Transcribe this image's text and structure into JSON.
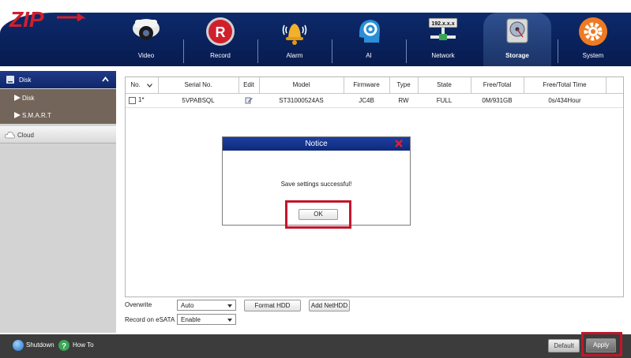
{
  "brand": {
    "logo_text": "ZIP"
  },
  "nav": {
    "items": [
      {
        "label": "Video",
        "icon": "camera-icon"
      },
      {
        "label": "Record",
        "icon": "record-icon"
      },
      {
        "label": "Alarm",
        "icon": "bell-icon"
      },
      {
        "label": "AI",
        "icon": "ai-head-icon"
      },
      {
        "label": "Network",
        "icon": "network-icon",
        "badge": "192.x.x.x"
      },
      {
        "label": "Storage",
        "icon": "hdd-icon",
        "active": true
      },
      {
        "label": "System",
        "icon": "gear-icon"
      }
    ]
  },
  "sidebar": {
    "disk_header": "Disk",
    "disk_items": [
      {
        "label": "Disk"
      },
      {
        "label": "S.M.A.R.T"
      }
    ],
    "cloud_header": "Cloud"
  },
  "table": {
    "headers": [
      "No.",
      "Serial No.",
      "Edit",
      "Model",
      "Firmware",
      "Type",
      "State",
      "Free/Total",
      "Free/Total Time"
    ],
    "rows": [
      {
        "no": "1*",
        "serial": "5VPABSQL",
        "model": "ST31000524AS",
        "firmware": "JC4B",
        "type": "RW",
        "state": "FULL",
        "free_total": "0M/931GB",
        "free_total_time": "0s/434Hour"
      }
    ]
  },
  "form": {
    "overwrite_label": "Overwrite",
    "overwrite_value": "Auto",
    "format_button": "Format HDD",
    "add_nethdd_button": "Add NetHDD",
    "esata_label": "Record on eSATA",
    "esata_value": "Enable"
  },
  "footer": {
    "shutdown_label": "Shutdown",
    "howto_label": "How To",
    "default_button": "Default",
    "apply_button": "Apply"
  },
  "modal": {
    "title": "Notice",
    "message": "Save settings successful!",
    "ok_button": "OK"
  },
  "colors": {
    "nav_bg": "#0d2a6b",
    "highlight": "#c0172b",
    "modal_title": "#1d3ea0",
    "sidebar_sub": "#736559"
  }
}
